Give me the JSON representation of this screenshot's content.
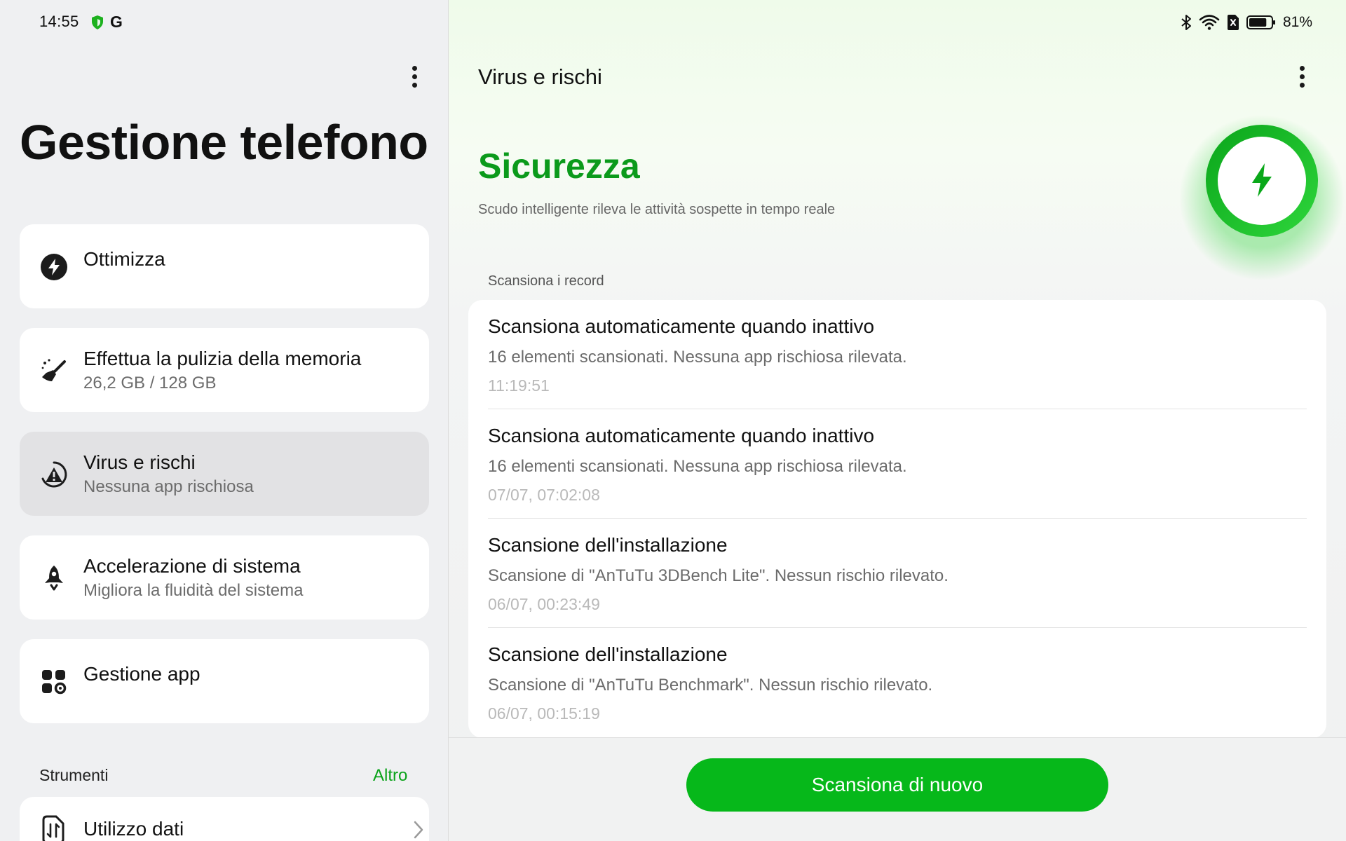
{
  "status_bar": {
    "time": "14:55",
    "left_icons": [
      "shield-icon",
      "google-g-icon"
    ],
    "google_letter": "G",
    "right_icons": [
      "bluetooth-icon",
      "wifi-icon",
      "sim-off-icon",
      "battery-icon"
    ],
    "battery_percent": "81%",
    "battery_level": 0.81
  },
  "left_pane": {
    "title": "Gestione telefono",
    "menu_items": [
      {
        "icon": "speed-bolt-icon",
        "title": "Ottimizza",
        "subtitle": ""
      },
      {
        "icon": "broom-icon",
        "title": "Effettua la pulizia della memoria",
        "subtitle": "26,2 GB / 128 GB"
      },
      {
        "icon": "risk-warning-icon",
        "title": "Virus e rischi",
        "subtitle": "Nessuna app rischiosa",
        "selected": true
      },
      {
        "icon": "rocket-icon",
        "title": "Accelerazione di sistema",
        "subtitle": "Migliora la fluidità del sistema"
      },
      {
        "icon": "app-grid-icon",
        "title": "Gestione app",
        "subtitle": ""
      }
    ],
    "tools": {
      "label": "Strumenti",
      "more_label": "Altro",
      "items": [
        {
          "icon": "data-usage-icon",
          "title": "Utilizzo dati"
        }
      ]
    }
  },
  "right_pane": {
    "title": "Virus e rischi",
    "security_title": "Sicurezza",
    "security_subtitle": "Scudo intelligente rileva le attività sospette in tempo reale",
    "scan_records_label": "Scansiona i record",
    "records": [
      {
        "title": "Scansiona automaticamente quando inattivo",
        "description": "16 elementi scansionati. Nessuna app rischiosa rilevata.",
        "time": "11:19:51"
      },
      {
        "title": "Scansiona automaticamente quando inattivo",
        "description": "16 elementi scansionati. Nessuna app rischiosa rilevata.",
        "time": "07/07, 07:02:08"
      },
      {
        "title": "Scansione dell'installazione",
        "description": "Scansione di \"AnTuTu 3DBench Lite\". Nessun rischio rilevato.",
        "time": "06/07, 00:23:49"
      },
      {
        "title": "Scansione dell'installazione",
        "description": "Scansione di \"AnTuTu Benchmark\". Nessun rischio rilevato.",
        "time": "06/07, 00:15:19"
      }
    ],
    "scan_again_label": "Scansiona di nuovo"
  },
  "colors": {
    "accent_green": "#06b81a",
    "security_green": "#0b9a1b",
    "left_bg": "#eff0f2",
    "selected_card": "#e2e2e4"
  }
}
